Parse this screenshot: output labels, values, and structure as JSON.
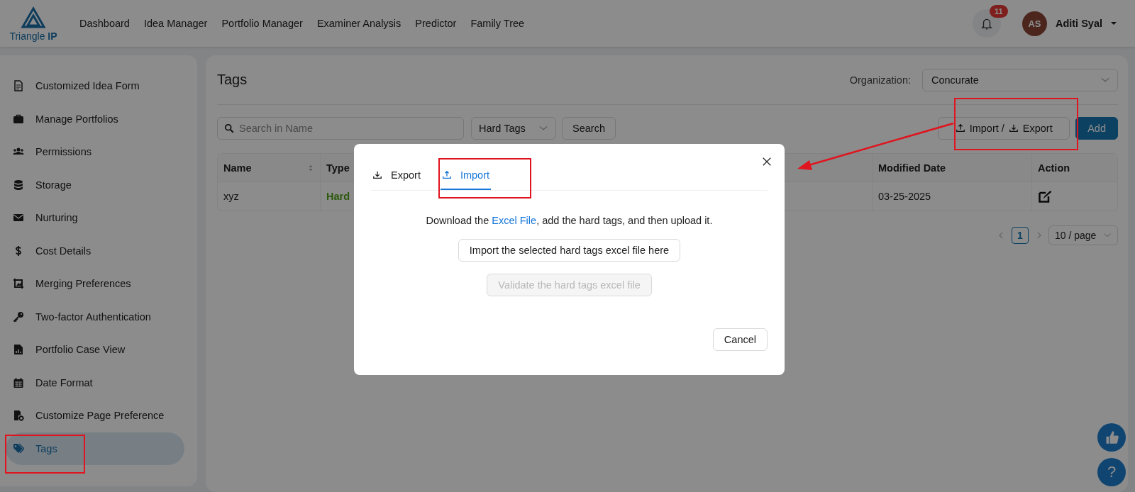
{
  "header": {
    "logo": {
      "name": "Triangle",
      "suffix": "IP"
    },
    "nav": [
      "Dashboard",
      "Idea Manager",
      "Portfolio Manager",
      "Examiner Analysis",
      "Predictor",
      "Family Tree"
    ],
    "notifications": {
      "count": "11"
    },
    "user": {
      "initials": "AS",
      "name": "Aditi Syal"
    }
  },
  "sidebar": {
    "items": [
      {
        "label": "Customized Idea Form",
        "kind": "document",
        "selected": false
      },
      {
        "label": "Manage Portfolios",
        "kind": "briefcase",
        "selected": false
      },
      {
        "label": "Permissions",
        "kind": "people",
        "selected": false
      },
      {
        "label": "Storage",
        "kind": "database",
        "selected": false
      },
      {
        "label": "Nurturing",
        "kind": "envelope",
        "selected": false
      },
      {
        "label": "Cost Details",
        "kind": "dollar",
        "selected": false
      },
      {
        "label": "Merging Preferences",
        "kind": "crop",
        "selected": false
      },
      {
        "label": "Two-factor Authentication",
        "kind": "key",
        "selected": false
      },
      {
        "label": "Portfolio Case View",
        "kind": "chartfile",
        "selected": false
      },
      {
        "label": "Date Format",
        "kind": "calendar",
        "selected": false
      },
      {
        "label": "Customize Page Preference",
        "kind": "gearfile",
        "selected": false
      },
      {
        "label": "Tags",
        "kind": "tag",
        "selected": true
      }
    ]
  },
  "page": {
    "title": "Tags",
    "organization": {
      "label": "Organization:",
      "value": "Concurate"
    },
    "search": {
      "placeholder": "Search in Name"
    },
    "filter": {
      "value": "Hard Tags"
    },
    "search_button": "Search",
    "import_export": {
      "import": "Import /",
      "export": "Export"
    },
    "add_button": "Add"
  },
  "table": {
    "columns": [
      {
        "label": "Name",
        "sortable": true
      },
      {
        "label": "Type",
        "sortable": false
      },
      {
        "label": "Modified Date",
        "sortable": false
      },
      {
        "label": "Action",
        "sortable": false
      }
    ],
    "rows": [
      {
        "name": "xyz",
        "type": "Hard",
        "modified": "03-25-2025"
      }
    ]
  },
  "pagination": {
    "pages": [
      {
        "label": "1",
        "selected": true
      }
    ],
    "page_size": "10 / page"
  },
  "modal": {
    "tabs": [
      {
        "label": "Export",
        "kind": "download",
        "selected": false
      },
      {
        "label": "Import",
        "kind": "upload",
        "selected": true
      }
    ],
    "instruction": {
      "before": "Download the ",
      "link": "Excel File",
      "after": ", add the hard tags, and then upload it."
    },
    "buttons": [
      {
        "label": "Import the selected hard tags excel file here",
        "disabled": false
      },
      {
        "label": "Validate the hard tags excel file",
        "disabled": true
      }
    ],
    "cancel": "Cancel"
  },
  "help_button": "?"
}
